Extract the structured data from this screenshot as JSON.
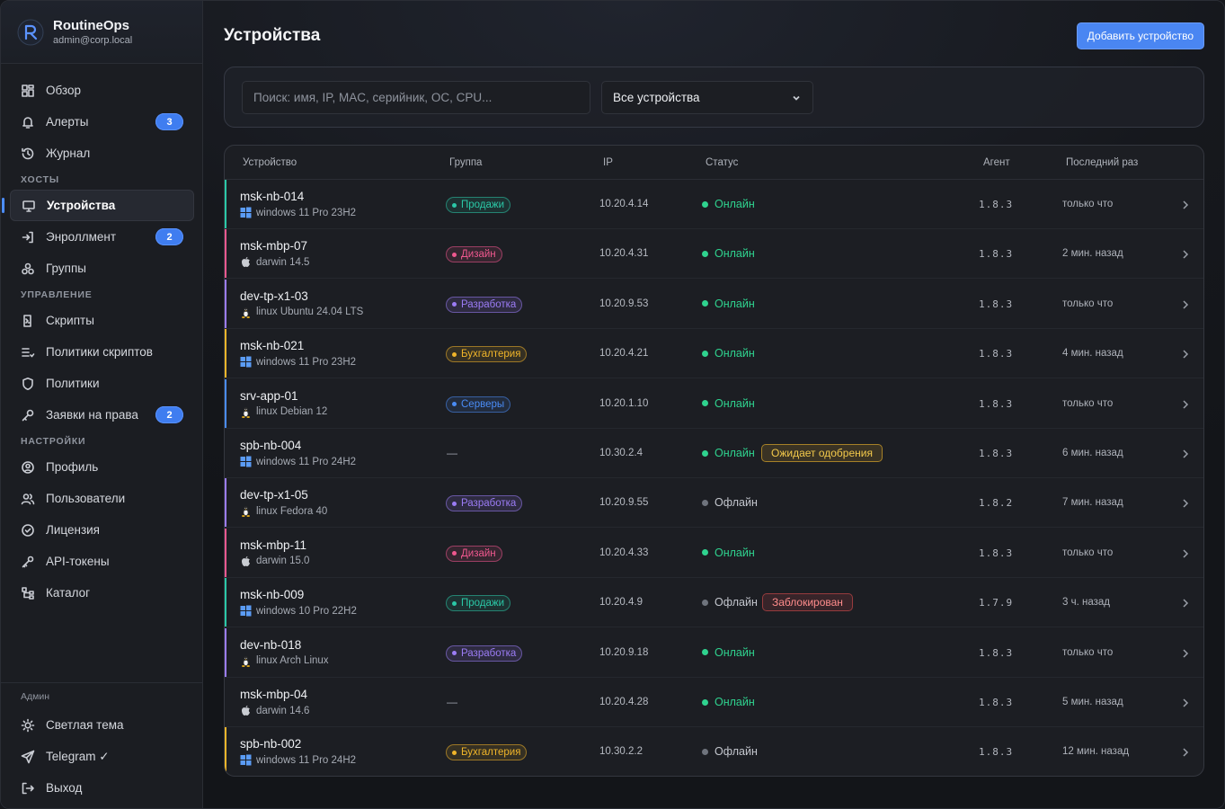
{
  "brand": {
    "name": "RoutineOps",
    "email": "admin@corp.local"
  },
  "nav": {
    "main": [
      {
        "label": "Обзор",
        "icon": "dashboard-icon"
      },
      {
        "label": "Алерты",
        "icon": "bell-icon",
        "badge": "3"
      },
      {
        "label": "Журнал",
        "icon": "history-icon"
      }
    ],
    "hosts_label": "ХОСТЫ",
    "hosts": [
      {
        "label": "Устройства",
        "icon": "monitor-icon",
        "active": true
      },
      {
        "label": "Энроллмент",
        "icon": "login-icon",
        "badge": "2"
      },
      {
        "label": "Группы",
        "icon": "groups-icon"
      }
    ],
    "manage_label": "УПРАВЛЕНИЕ",
    "manage": [
      {
        "label": "Скрипты",
        "icon": "script-icon"
      },
      {
        "label": "Политики скриптов",
        "icon": "list-icon"
      },
      {
        "label": "Политики",
        "icon": "shield-icon"
      },
      {
        "label": "Заявки на права",
        "icon": "key-icon",
        "badge": "2"
      }
    ],
    "settings_label": "НАСТРОЙКИ",
    "settings": [
      {
        "label": "Профиль",
        "icon": "profile-icon"
      },
      {
        "label": "Пользователи",
        "icon": "users-icon"
      },
      {
        "label": "Лицензия",
        "icon": "check-circle-icon"
      },
      {
        "label": "API-токены",
        "icon": "token-icon"
      },
      {
        "label": "Каталог",
        "icon": "catalog-icon"
      }
    ],
    "admin_label": "Админ",
    "admin": [
      {
        "label": "Светлая тема",
        "icon": "sun-icon"
      },
      {
        "label": "Telegram ✓",
        "icon": "send-icon"
      },
      {
        "label": "Выход",
        "icon": "logout-icon"
      }
    ]
  },
  "page": {
    "title": "Устройства",
    "add_button": "Добавить устройство",
    "search_placeholder": "Поиск: имя, IP, MAC, серийник, ОС, CPU...",
    "filter_value": "Все устройства"
  },
  "table": {
    "headers": [
      "Устройство",
      "Группа",
      "IP",
      "Статус",
      "Агент",
      "Последний раз"
    ],
    "rows": [
      {
        "name": "msk-nb-014",
        "os": "windows 11 Pro 23H2",
        "os_icon": "windows-icon",
        "group": "Продажи",
        "group_color": "teal",
        "ip": "10.20.4.14",
        "status": "Онлайн",
        "online": true,
        "flag": "",
        "agent": "1.8.3",
        "last": "только что"
      },
      {
        "name": "msk-mbp-07",
        "os": "darwin 14.5",
        "os_icon": "apple-icon",
        "group": "Дизайн",
        "group_color": "pink",
        "ip": "10.20.4.31",
        "status": "Онлайн",
        "online": true,
        "flag": "",
        "agent": "1.8.3",
        "last": "2 мин. назад"
      },
      {
        "name": "dev-tp-x1-03",
        "os": "linux Ubuntu 24.04 LTS",
        "os_icon": "linux-icon",
        "group": "Разработка",
        "group_color": "violet",
        "ip": "10.20.9.53",
        "status": "Онлайн",
        "online": true,
        "flag": "",
        "agent": "1.8.3",
        "last": "только что"
      },
      {
        "name": "msk-nb-021",
        "os": "windows 11 Pro 23H2",
        "os_icon": "windows-icon",
        "group": "Бухгалтерия",
        "group_color": "amber",
        "ip": "10.20.4.21",
        "status": "Онлайн",
        "online": true,
        "flag": "",
        "agent": "1.8.3",
        "last": "4 мин. назад"
      },
      {
        "name": "srv-app-01",
        "os": "linux Debian 12",
        "os_icon": "linux-icon",
        "group": "Серверы",
        "group_color": "blue",
        "ip": "10.20.1.10",
        "status": "Онлайн",
        "online": true,
        "flag": "",
        "agent": "1.8.3",
        "last": "только что"
      },
      {
        "name": "spb-nb-004",
        "os": "windows 11 Pro 24H2",
        "os_icon": "windows-icon",
        "group": "",
        "group_color": "none",
        "ip": "10.30.2.4",
        "status": "Онлайн",
        "online": true,
        "flag": "Ожидает одобрения",
        "flag_kind": "pending",
        "agent": "1.8.3",
        "last": "6 мин. назад"
      },
      {
        "name": "dev-tp-x1-05",
        "os": "linux Fedora 40",
        "os_icon": "linux-icon",
        "group": "Разработка",
        "group_color": "violet",
        "ip": "10.20.9.55",
        "status": "Офлайн",
        "online": false,
        "flag": "",
        "agent": "1.8.2",
        "last": "7 мин. назад"
      },
      {
        "name": "msk-mbp-11",
        "os": "darwin 15.0",
        "os_icon": "apple-icon",
        "group": "Дизайн",
        "group_color": "pink",
        "ip": "10.20.4.33",
        "status": "Онлайн",
        "online": true,
        "flag": "",
        "agent": "1.8.3",
        "last": "только что"
      },
      {
        "name": "msk-nb-009",
        "os": "windows 10 Pro 22H2",
        "os_icon": "windows-icon",
        "group": "Продажи",
        "group_color": "teal",
        "ip": "10.20.4.9",
        "status": "Офлайн",
        "online": false,
        "flag": "Заблокирован",
        "flag_kind": "blocked",
        "agent": "1.7.9",
        "last": "3 ч. назад"
      },
      {
        "name": "dev-nb-018",
        "os": "linux Arch Linux",
        "os_icon": "linux-icon",
        "group": "Разработка",
        "group_color": "violet",
        "ip": "10.20.9.18",
        "status": "Онлайн",
        "online": true,
        "flag": "",
        "agent": "1.8.3",
        "last": "только что"
      },
      {
        "name": "msk-mbp-04",
        "os": "darwin 14.6",
        "os_icon": "apple-icon",
        "group": "",
        "group_color": "none",
        "ip": "10.20.4.28",
        "status": "Онлайн",
        "online": true,
        "flag": "",
        "agent": "1.8.3",
        "last": "5 мин. назад"
      },
      {
        "name": "spb-nb-002",
        "os": "windows 11 Pro 24H2",
        "os_icon": "windows-icon",
        "group": "Бухгалтерия",
        "group_color": "amber",
        "ip": "10.30.2.2",
        "status": "Офлайн",
        "online": false,
        "flag": "",
        "agent": "1.8.3",
        "last": "12 мин. назад"
      }
    ],
    "empty_group": "—"
  },
  "colors": {
    "accent": "#4a86f2",
    "online": "#2fd38f",
    "offline": "#6f747d",
    "teal": "#2bc8a7",
    "pink": "#f0588f",
    "violet": "#9b7cf5",
    "amber": "#f0b52a",
    "blue": "#4a8cf6"
  }
}
